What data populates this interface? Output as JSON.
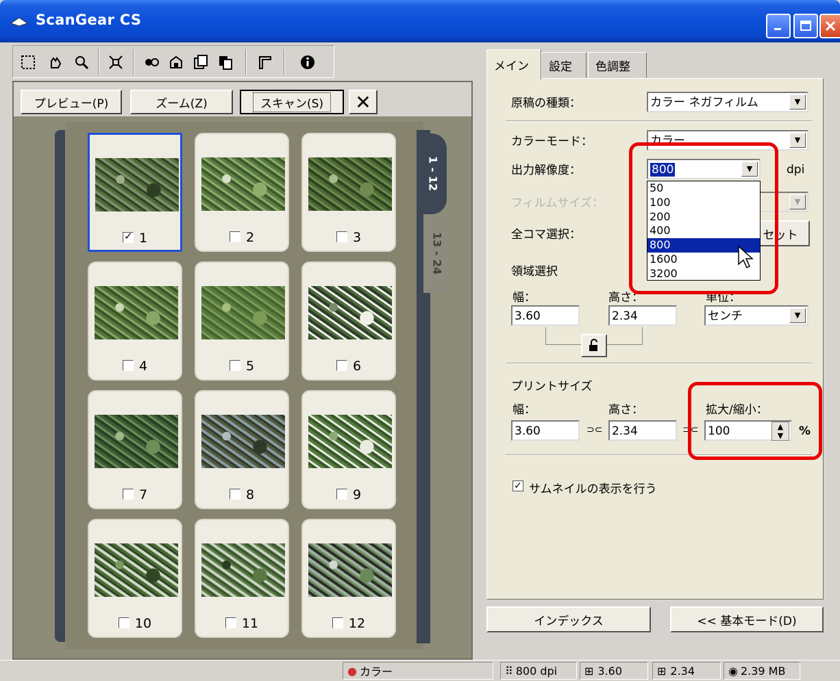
{
  "window": {
    "title": "ScanGear CS"
  },
  "toolbar": {
    "icons": [
      "marquee-select-icon",
      "hand-icon",
      "zoom-icon",
      "auto-crop-icon",
      "mirror-icon",
      "rotate-icon",
      "multi-crop-icon",
      "copy-icon",
      "ruler-icon",
      "info-icon"
    ]
  },
  "left": {
    "preview_label": "プレビュー(P)",
    "zoom_label": "ズーム(Z)",
    "scan_label": "スキャン(S)",
    "close_label": "✕",
    "strip_tabs": [
      "1 - 12",
      "13 - 24"
    ],
    "thumbnails": [
      {
        "num": "1",
        "checked": true
      },
      {
        "num": "2",
        "checked": false
      },
      {
        "num": "3",
        "checked": false
      },
      {
        "num": "4",
        "checked": false
      },
      {
        "num": "5",
        "checked": false
      },
      {
        "num": "6",
        "checked": false
      },
      {
        "num": "7",
        "checked": false
      },
      {
        "num": "8",
        "checked": false
      },
      {
        "num": "9",
        "checked": false
      },
      {
        "num": "10",
        "checked": false
      },
      {
        "num": "11",
        "checked": false
      },
      {
        "num": "12",
        "checked": false
      }
    ]
  },
  "right": {
    "tabs": [
      "メイン",
      "設定",
      "色調整"
    ],
    "doc_type_label": "原稿の種類：",
    "doc_type_value": "カラー ネガフィルム",
    "color_mode_label": "カラーモード：",
    "color_mode_value": "カラー",
    "resolution_label": "出力解像度：",
    "resolution_value": "800",
    "resolution_unit": "dpi",
    "resolution_options": [
      "50",
      "100",
      "200",
      "400",
      "800",
      "1600",
      "3200"
    ],
    "resolution_selected_index": 4,
    "film_size_label": "フィルムサイズ：",
    "all_frames_label": "全コマ選択：",
    "reset_label": "セット",
    "area_label": "領域選択",
    "width_label": "幅：",
    "height_label": "高さ：",
    "unit_label": "単位：",
    "width_value": "3.60",
    "height_value": "2.34",
    "unit_value": "センチ",
    "print_size_label": "プリントサイズ",
    "print_width_label": "幅：",
    "print_height_label": "高さ：",
    "scale_label": "拡大/縮小：",
    "print_width_value": "3.60",
    "print_height_value": "2.34",
    "scale_value": "100",
    "scale_unit": "%",
    "thumbnail_display_label": "サムネイルの表示を行う",
    "index_button": "インデックス",
    "basic_mode_button": "<< 基本モード(D)"
  },
  "status": {
    "color": "カラー",
    "dpi": "800 dpi",
    "width": "3.60",
    "height": "2.34",
    "size": "2.39 MB"
  },
  "colors": {
    "title_blue": "#0b4fd8",
    "highlight_red": "#e80000",
    "selection_blue": "#0a26a8"
  }
}
